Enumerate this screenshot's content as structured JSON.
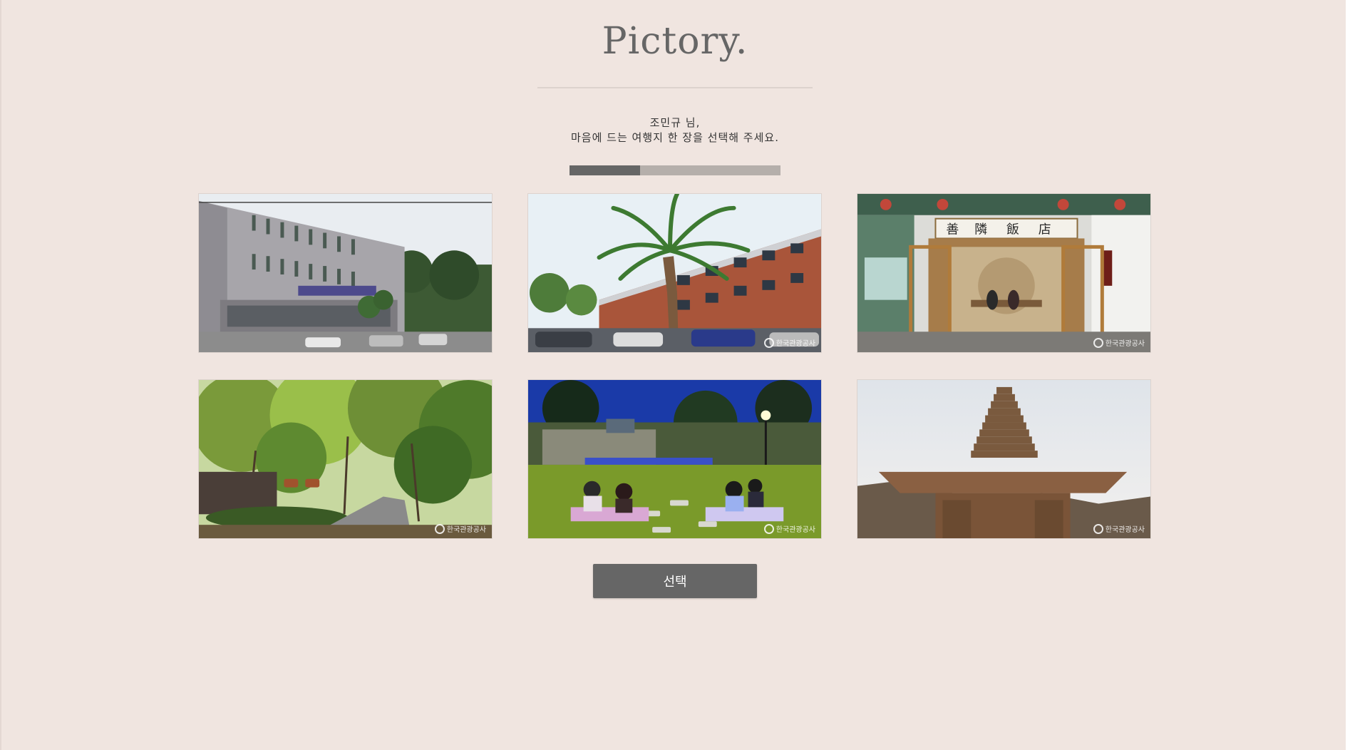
{
  "app": {
    "logo": "Pictory."
  },
  "greeting": {
    "line1": "조민규 님,",
    "line2": "마음에 드는 여행지 한 장을 선택해 주세요."
  },
  "progress": {
    "fraction": 0.333
  },
  "photos": [
    {
      "name": "photo-office-building",
      "watermark": ""
    },
    {
      "name": "photo-palm-tree-building",
      "watermark": "한국관광공사"
    },
    {
      "name": "photo-restaurant-entrance",
      "watermark": "한국관광공사"
    },
    {
      "name": "photo-forest-road",
      "watermark": "한국관광공사"
    },
    {
      "name": "photo-night-concert-park",
      "watermark": "한국관광공사"
    },
    {
      "name": "photo-stone-pagoda",
      "watermark": "한국관광공사"
    }
  ],
  "actions": {
    "select_label": "선택"
  }
}
